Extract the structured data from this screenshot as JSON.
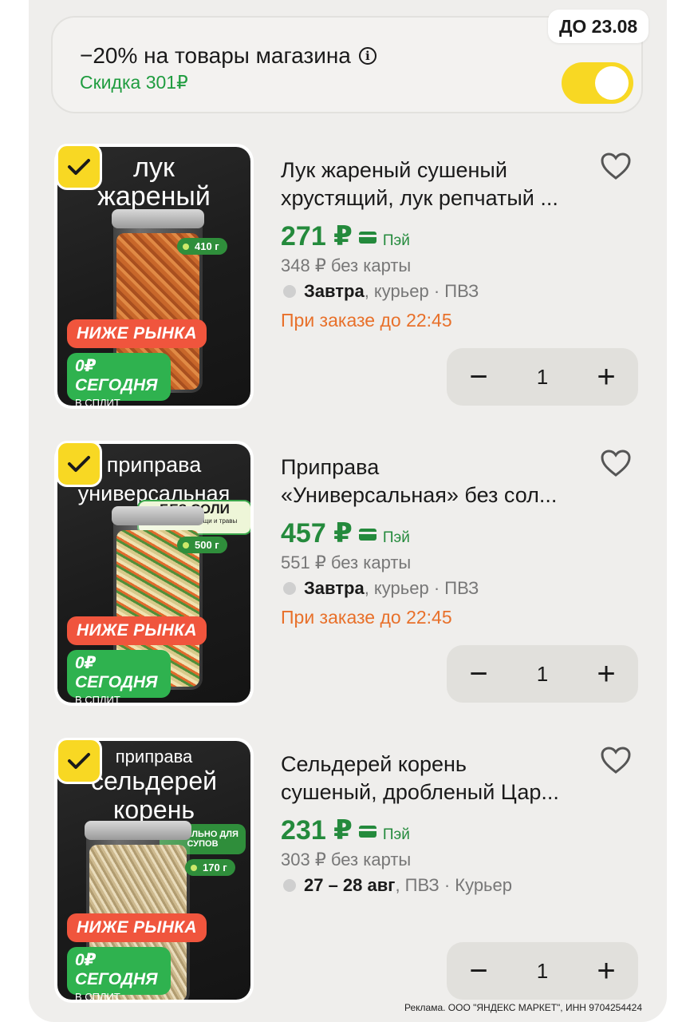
{
  "promo": {
    "title": "−20% на товары магазина",
    "discount": "Скидка 301₽",
    "badge": "ДО 23.08",
    "toggle_on": true
  },
  "products": [
    {
      "image": {
        "line1": "лук",
        "line2": "жареный",
        "weight": "410 г",
        "tag_red": "НИЖЕ РЫНКА",
        "tag_green": "0₽ СЕГОДНЯ",
        "tag_green_sub": "В СПЛИТ"
      },
      "title_line1": "Лук жареный сушеный",
      "title_line2": "хрустящий, лук репчатый ...",
      "price": "271 ₽",
      "pay_label": "Пэй",
      "old_price": "348 ₽ без карты",
      "delivery_bold": "Завтра",
      "delivery_rest": ", курьер · ПВЗ",
      "order_note": "При заказе до 22:45",
      "qty": "1"
    },
    {
      "image": {
        "line1": "приправа",
        "line2": "универсальная",
        "badge": "БЕЗ СОЛИ",
        "badge_sub": "натуральные овощи и травы",
        "weight": "500 г",
        "tag_red": "НИЖЕ РЫНКА",
        "tag_green": "0₽ СЕГОДНЯ",
        "tag_green_sub": "В СПЛИТ"
      },
      "title_line1": "Приправа",
      "title_line2": "«Универсальная» без сол...",
      "price": "457 ₽",
      "pay_label": "Пэй",
      "old_price": "551 ₽ без карты",
      "delivery_bold": "Завтра",
      "delivery_rest": ", курьер · ПВЗ",
      "order_note": "При заказе до 22:45",
      "qty": "1"
    },
    {
      "image": {
        "line1": "приправа",
        "line2": "сельдерей корень",
        "badge": "ИДЕАЛЬНО ДЛЯ СУПОВ",
        "weight": "170 г",
        "tag_red": "НИЖЕ РЫНКА",
        "tag_green": "0₽ СЕГОДНЯ",
        "tag_green_sub": "В СПЛИТ"
      },
      "title_line1": "Сельдерей корень",
      "title_line2": "сушеный, дробленый Цар...",
      "price": "231 ₽",
      "pay_label": "Пэй",
      "old_price": "303 ₽ без карты",
      "delivery_bold": "27 – 28 авг",
      "delivery_rest": ", ПВЗ · Курьер",
      "order_note": "",
      "qty": "1"
    }
  ],
  "footer": {
    "ad_note": "Реклама. ООО \"ЯНДЕКС МАРКЕТ\", ИНН 9704254424"
  },
  "colors": {
    "accent_yellow": "#f8d823",
    "price_green": "#248a3c",
    "order_orange": "#e8702a"
  }
}
